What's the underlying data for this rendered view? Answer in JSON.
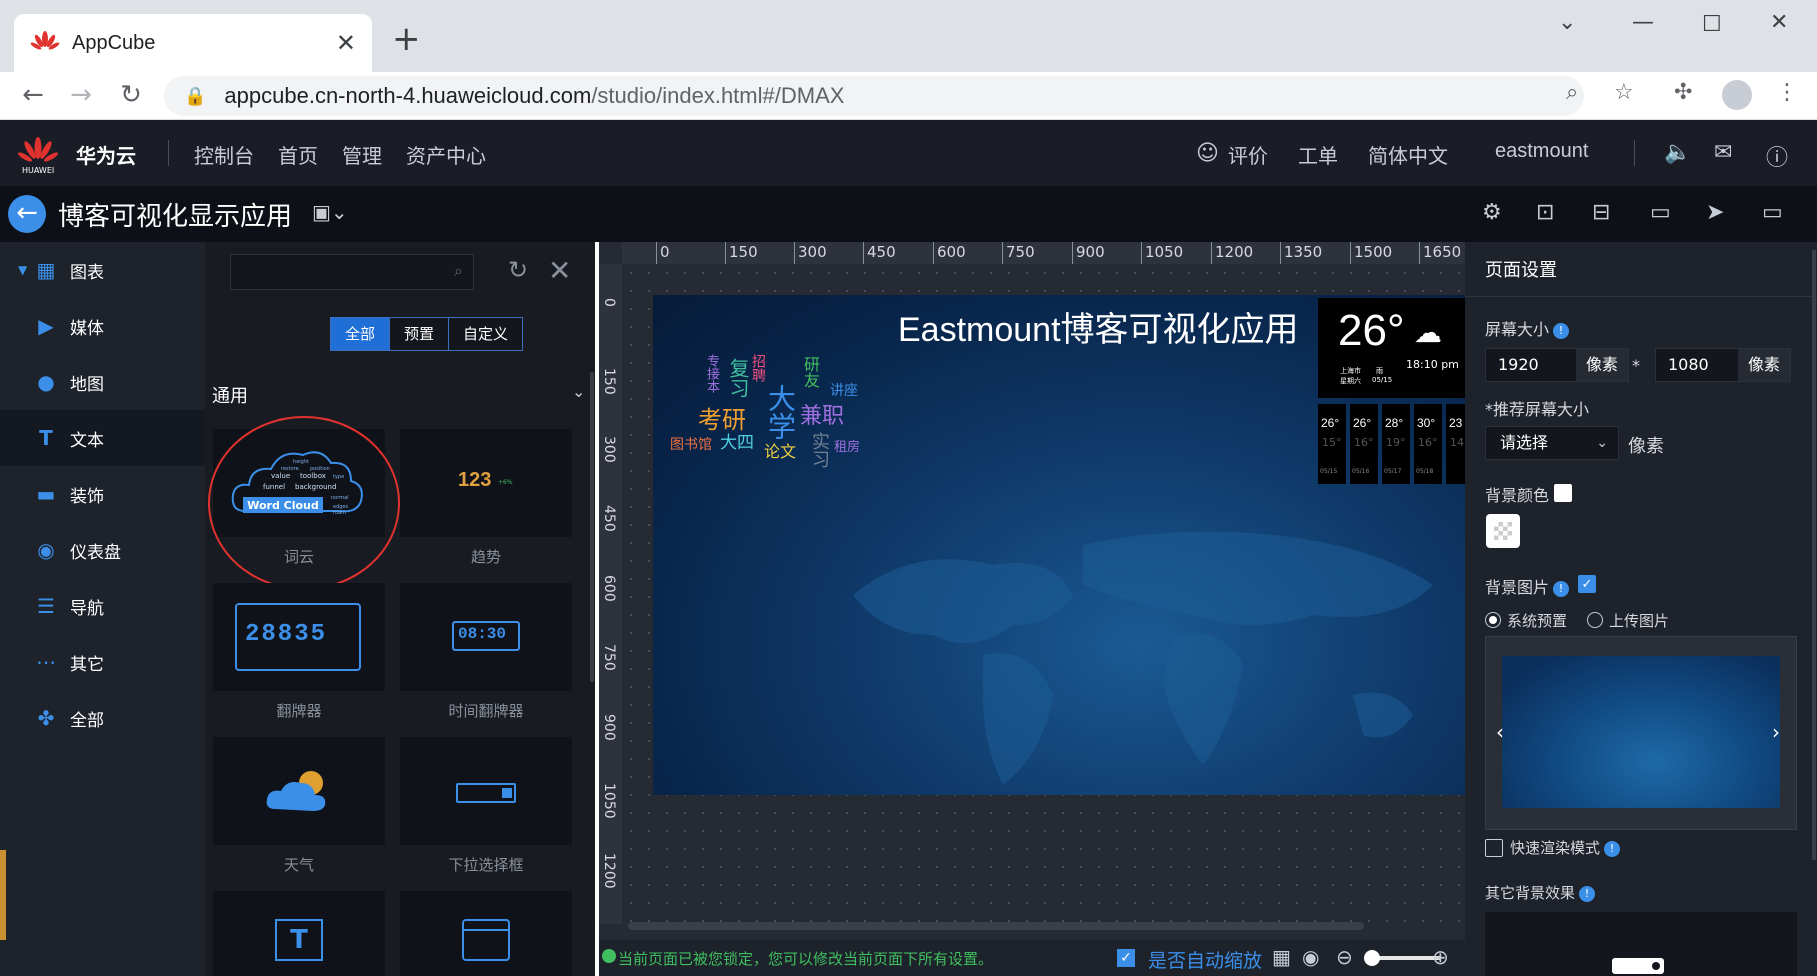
{
  "browser": {
    "tab_title": "AppCube",
    "url_host": "appcube.cn-north-4.huaweicloud.com",
    "url_path": "/studio/index.html#/DMAX"
  },
  "header": {
    "brand": "华为云",
    "logo_text": "HUAWEI",
    "nav": [
      "控制台",
      "首页",
      "管理",
      "资产中心"
    ],
    "feedback": "评价",
    "tickets": "工单",
    "language": "简体中文",
    "user": "eastmount"
  },
  "studio": {
    "app_title": "博客可视化显示应用"
  },
  "categories": [
    {
      "label": "图表",
      "icon": "grid-icon"
    },
    {
      "label": "媒体",
      "icon": "media-icon"
    },
    {
      "label": "地图",
      "icon": "map-pin-icon"
    },
    {
      "label": "文本",
      "icon": "text-icon"
    },
    {
      "label": "装饰",
      "icon": "paint-roller-icon"
    },
    {
      "label": "仪表盘",
      "icon": "dashboard-icon"
    },
    {
      "label": "导航",
      "icon": "list-icon"
    },
    {
      "label": "其它",
      "icon": "more-icon"
    },
    {
      "label": "全部",
      "icon": "all-icon"
    }
  ],
  "components": {
    "search_placeholder": "",
    "filter_tabs": [
      "全部",
      "预置",
      "自定义"
    ],
    "section": "通用",
    "items": [
      "词云",
      "趋势",
      "翻牌器",
      "时间翻牌器",
      "天气",
      "下拉选择框"
    ],
    "trend_value": "123",
    "trend_pct": "+6%",
    "wordcloud_badge": "Word Cloud",
    "wordcloud_words": [
      "height",
      "value",
      "toolbox",
      "funnel",
      "background",
      "normal",
      "position",
      "type",
      "restore",
      "edges",
      "roam"
    ],
    "flip_digits": "28835",
    "time_flip": "08:30"
  },
  "ruler": {
    "h": [
      "0",
      "150",
      "300",
      "450",
      "600",
      "750",
      "900",
      "1050",
      "1200",
      "1350",
      "1500",
      "1650"
    ],
    "v": [
      "0",
      "150",
      "300",
      "450",
      "600",
      "750",
      "900",
      "1050",
      "1200"
    ]
  },
  "stage": {
    "title": "Eastmount博客可视化应用",
    "words": [
      {
        "t": "考研",
        "c": "#f0a030"
      },
      {
        "t": "大学",
        "c": "#3b8fe8"
      },
      {
        "t": "兼职",
        "c": "#a070e0"
      },
      {
        "t": "大四",
        "c": "#4fd0e0"
      },
      {
        "t": "论文",
        "c": "#f0d040"
      },
      {
        "t": "图书馆",
        "c": "#f07040"
      },
      {
        "t": "租房",
        "c": "#a070e0"
      },
      {
        "t": "讲座",
        "c": "#3b8fe8"
      },
      {
        "t": "研友",
        "c": "#40c060"
      },
      {
        "t": "招聘",
        "c": "#f05080"
      },
      {
        "t": "复习",
        "c": "#40c0a0"
      },
      {
        "t": "专接本",
        "c": "#a070e0"
      },
      {
        "t": "实习",
        "c": "#708090"
      }
    ],
    "weather": {
      "temp": "26°",
      "time": "18:10 pm",
      "city": "上海市",
      "weekday": "星期六",
      "cond": "雨",
      "date": "05/15",
      "days": [
        {
          "hi": "26°",
          "lo": "15°",
          "d": "05/15"
        },
        {
          "hi": "26°",
          "lo": "16°",
          "d": "05/16"
        },
        {
          "hi": "28°",
          "lo": "19°",
          "d": "05/17"
        },
        {
          "hi": "30°",
          "lo": "16°",
          "d": "05/18"
        },
        {
          "hi": "23",
          "lo": "14",
          "d": ""
        }
      ]
    }
  },
  "status": {
    "locked_msg": "当前页面已被您锁定，您可以修改当前页面下所有设置。",
    "auto_zoom": "是否自动缩放"
  },
  "props": {
    "title": "页面设置",
    "screen_size_label": "屏幕大小",
    "width": "1920",
    "height": "1080",
    "unit": "像素",
    "times": "*",
    "recommended_label": "*推荐屏幕大小",
    "recommended_value": "请选择",
    "recommended_unit": "像素",
    "bg_color_label": "背景颜色",
    "bg_image_label": "背景图片",
    "radio_system": "系统预置",
    "radio_upload": "上传图片",
    "fast_render": "快速渲染模式",
    "other_bg": "其它背景效果"
  }
}
